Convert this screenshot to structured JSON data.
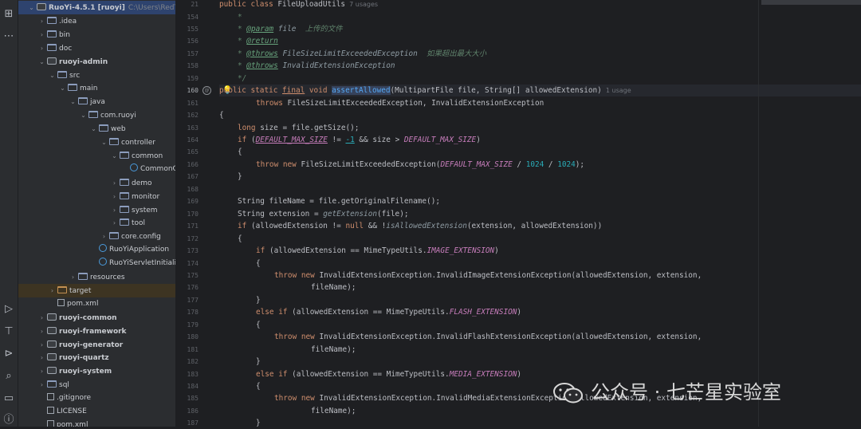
{
  "project_tree": [
    {
      "depth": 0,
      "arrow": "v",
      "icon": "module",
      "label": "RuoYi-4.5.1 [ruoyi]",
      "path": "C:\\Users\\RedTeam",
      "bold": true
    },
    {
      "depth": 1,
      "arrow": ">",
      "icon": "folder",
      "label": ".idea"
    },
    {
      "depth": 1,
      "arrow": ">",
      "icon": "folder",
      "label": "bin"
    },
    {
      "depth": 1,
      "arrow": ">",
      "icon": "folder",
      "label": "doc"
    },
    {
      "depth": 1,
      "arrow": "v",
      "icon": "module",
      "label": "ruoyi-admin",
      "bold": true
    },
    {
      "depth": 2,
      "arrow": "v",
      "icon": "folder",
      "label": "src"
    },
    {
      "depth": 3,
      "arrow": "v",
      "icon": "folder",
      "label": "main"
    },
    {
      "depth": 4,
      "arrow": "v",
      "icon": "folder",
      "label": "java"
    },
    {
      "depth": 5,
      "arrow": "v",
      "icon": "folder",
      "label": "com.ruoyi"
    },
    {
      "depth": 6,
      "arrow": "v",
      "icon": "folder",
      "label": "web"
    },
    {
      "depth": 7,
      "arrow": "v",
      "icon": "folder",
      "label": "controller"
    },
    {
      "depth": 8,
      "arrow": "v",
      "icon": "folder",
      "label": "common"
    },
    {
      "depth": 9,
      "arrow": "",
      "icon": "class",
      "label": "CommonC"
    },
    {
      "depth": 8,
      "arrow": ">",
      "icon": "folder",
      "label": "demo"
    },
    {
      "depth": 8,
      "arrow": ">",
      "icon": "folder",
      "label": "monitor"
    },
    {
      "depth": 8,
      "arrow": ">",
      "icon": "folder",
      "label": "system"
    },
    {
      "depth": 8,
      "arrow": ">",
      "icon": "folder",
      "label": "tool"
    },
    {
      "depth": 7,
      "arrow": ">",
      "icon": "folder",
      "label": "core.config"
    },
    {
      "depth": 6,
      "arrow": "",
      "icon": "class",
      "label": "RuoYiApplication"
    },
    {
      "depth": 6,
      "arrow": "",
      "icon": "class",
      "label": "RuoYiServletInitializ"
    },
    {
      "depth": 4,
      "arrow": ">",
      "icon": "folder",
      "label": "resources"
    },
    {
      "depth": 2,
      "arrow": ">",
      "icon": "folder-orange",
      "label": "target",
      "highlight": true
    },
    {
      "depth": 2,
      "arrow": "",
      "icon": "file",
      "label": "pom.xml"
    },
    {
      "depth": 1,
      "arrow": ">",
      "icon": "module",
      "label": "ruoyi-common",
      "bold": true
    },
    {
      "depth": 1,
      "arrow": ">",
      "icon": "module",
      "label": "ruoyi-framework",
      "bold": true
    },
    {
      "depth": 1,
      "arrow": ">",
      "icon": "module",
      "label": "ruoyi-generator",
      "bold": true
    },
    {
      "depth": 1,
      "arrow": ">",
      "icon": "module",
      "label": "ruoyi-quartz",
      "bold": true
    },
    {
      "depth": 1,
      "arrow": ">",
      "icon": "module",
      "label": "ruoyi-system",
      "bold": true
    },
    {
      "depth": 1,
      "arrow": ">",
      "icon": "folder",
      "label": "sql"
    },
    {
      "depth": 1,
      "arrow": "",
      "icon": "file",
      "label": ".gitignore"
    },
    {
      "depth": 1,
      "arrow": "",
      "icon": "file",
      "label": "LICENSE"
    },
    {
      "depth": 1,
      "arrow": "",
      "icon": "file",
      "label": "pom.xml"
    }
  ],
  "sticky_header": {
    "line": "21",
    "code": [
      [
        "kw",
        "public class "
      ],
      [
        "",
        "FileUploadUtils"
      ],
      [
        "hint",
        "  7 usages"
      ]
    ]
  },
  "code_lines": [
    {
      "n": "154",
      "i": 1,
      "t": [
        [
          "doc",
          "*"
        ]
      ]
    },
    {
      "n": "155",
      "i": 1,
      "t": [
        [
          "doc",
          "* "
        ],
        [
          "tag",
          "@param"
        ],
        [
          "cn",
          " file "
        ],
        [
          "doc",
          " 上传的文件"
        ]
      ]
    },
    {
      "n": "156",
      "i": 1,
      "t": [
        [
          "doc",
          "* "
        ],
        [
          "tag",
          "@return"
        ]
      ]
    },
    {
      "n": "157",
      "i": 1,
      "t": [
        [
          "doc",
          "* "
        ],
        [
          "tag",
          "@throws"
        ],
        [
          "cn",
          " FileSizeLimitExceededException "
        ],
        [
          "doc",
          " 如果超出最大大小"
        ]
      ]
    },
    {
      "n": "158",
      "i": 1,
      "t": [
        [
          "doc",
          "* "
        ],
        [
          "tag",
          "@throws"
        ],
        [
          "cn",
          " InvalidExtensionException"
        ]
      ]
    },
    {
      "n": "159",
      "i": 1,
      "t": [
        [
          "doc",
          "*/"
        ]
      ]
    },
    {
      "n": "160",
      "i": 0,
      "cur": true,
      "t": [
        [
          "kw",
          "public static "
        ],
        [
          "kw ul",
          "final"
        ],
        [
          "kw",
          " void "
        ],
        [
          "fn hl",
          "assertAllowed"
        ],
        [
          "",
          "(MultipartFile file, String[] allowedExtension)"
        ],
        [
          "hint",
          "  1 usage"
        ]
      ]
    },
    {
      "n": "161",
      "i": 2,
      "t": [
        [
          "kw",
          "throws "
        ],
        [
          "",
          "FileSizeLimitExceededException, InvalidExtensionException"
        ]
      ]
    },
    {
      "n": "162",
      "i": 0,
      "t": [
        [
          "",
          "{"
        ]
      ]
    },
    {
      "n": "163",
      "i": 1,
      "t": [
        [
          "kw",
          "long "
        ],
        [
          "",
          "size = file.getSize();"
        ]
      ]
    },
    {
      "n": "164",
      "i": 1,
      "t": [
        [
          "kw",
          "if "
        ],
        [
          "",
          "("
        ],
        [
          "cst ul",
          "DEFAULT_MAX_SIZE"
        ],
        [
          "",
          " != "
        ],
        [
          "num ul",
          "-1"
        ],
        [
          "",
          " && size > "
        ],
        [
          "cst",
          "DEFAULT_MAX_SIZE"
        ],
        [
          "",
          ")"
        ]
      ]
    },
    {
      "n": "165",
      "i": 1,
      "t": [
        [
          "",
          "{"
        ]
      ]
    },
    {
      "n": "166",
      "i": 2,
      "t": [
        [
          "kw",
          "throw new "
        ],
        [
          "",
          "FileSizeLimitExceededException("
        ],
        [
          "cst",
          "DEFAULT_MAX_SIZE"
        ],
        [
          "",
          " / "
        ],
        [
          "num",
          "1024"
        ],
        [
          "",
          " / "
        ],
        [
          "num",
          "1024"
        ],
        [
          "",
          ");"
        ]
      ]
    },
    {
      "n": "167",
      "i": 1,
      "t": [
        [
          "",
          "}"
        ]
      ]
    },
    {
      "n": "168",
      "i": 0,
      "t": []
    },
    {
      "n": "169",
      "i": 1,
      "t": [
        [
          "",
          "String fileName = file.getOriginalFilename();"
        ]
      ]
    },
    {
      "n": "170",
      "i": 1,
      "t": [
        [
          "",
          "String extension = "
        ],
        [
          "cn",
          "getExtension"
        ],
        [
          "",
          "(file);"
        ]
      ]
    },
    {
      "n": "171",
      "i": 1,
      "t": [
        [
          "kw",
          "if "
        ],
        [
          "",
          "(allowedExtension != "
        ],
        [
          "kw",
          "null"
        ],
        [
          "",
          " && !"
        ],
        [
          "cn",
          "isAllowedExtension"
        ],
        [
          "",
          "(extension, allowedExtension))"
        ]
      ]
    },
    {
      "n": "172",
      "i": 1,
      "t": [
        [
          "",
          "{"
        ]
      ]
    },
    {
      "n": "173",
      "i": 2,
      "t": [
        [
          "kw",
          "if "
        ],
        [
          "",
          "(allowedExtension == MimeTypeUtils."
        ],
        [
          "cst",
          "IMAGE_EXTENSION"
        ],
        [
          "",
          ")"
        ]
      ]
    },
    {
      "n": "174",
      "i": 2,
      "t": [
        [
          "",
          "{"
        ]
      ]
    },
    {
      "n": "175",
      "i": 3,
      "t": [
        [
          "kw",
          "throw new "
        ],
        [
          "",
          "InvalidExtensionException.InvalidImageExtensionException(allowedExtension, extension,"
        ]
      ]
    },
    {
      "n": "176",
      "i": 5,
      "t": [
        [
          "",
          "fileName);"
        ]
      ]
    },
    {
      "n": "177",
      "i": 2,
      "t": [
        [
          "",
          "}"
        ]
      ]
    },
    {
      "n": "178",
      "i": 2,
      "t": [
        [
          "kw",
          "else if "
        ],
        [
          "",
          "(allowedExtension == MimeTypeUtils."
        ],
        [
          "cst",
          "FLASH_EXTENSION"
        ],
        [
          "",
          ")"
        ]
      ]
    },
    {
      "n": "179",
      "i": 2,
      "t": [
        [
          "",
          "{"
        ]
      ]
    },
    {
      "n": "180",
      "i": 3,
      "t": [
        [
          "kw",
          "throw new "
        ],
        [
          "",
          "InvalidExtensionException.InvalidFlashExtensionException(allowedExtension, extension,"
        ]
      ]
    },
    {
      "n": "181",
      "i": 5,
      "t": [
        [
          "",
          "fileName);"
        ]
      ]
    },
    {
      "n": "182",
      "i": 2,
      "t": [
        [
          "",
          "}"
        ]
      ]
    },
    {
      "n": "183",
      "i": 2,
      "t": [
        [
          "kw",
          "else if "
        ],
        [
          "",
          "(allowedExtension == MimeTypeUtils."
        ],
        [
          "cst",
          "MEDIA_EXTENSION"
        ],
        [
          "",
          ")"
        ]
      ]
    },
    {
      "n": "184",
      "i": 2,
      "t": [
        [
          "",
          "{"
        ]
      ]
    },
    {
      "n": "185",
      "i": 3,
      "t": [
        [
          "kw",
          "throw new "
        ],
        [
          "",
          "InvalidExtensionException.InvalidMediaExtensionException(allowedExtension, extension,"
        ]
      ]
    },
    {
      "n": "186",
      "i": 5,
      "t": [
        [
          "",
          "fileName);"
        ]
      ]
    },
    {
      "n": "187",
      "i": 2,
      "t": [
        [
          "",
          "}"
        ]
      ]
    }
  ],
  "watermark": {
    "text": "公众号 · 七芒星实验室"
  },
  "colors": {
    "keyword": "#cf8e6d",
    "function": "#56a8f5",
    "constant": "#c77dbb",
    "number": "#2aacb8",
    "doc_comment": "#5f826b",
    "background": "#1e1f22",
    "panel": "#2b2d30"
  }
}
